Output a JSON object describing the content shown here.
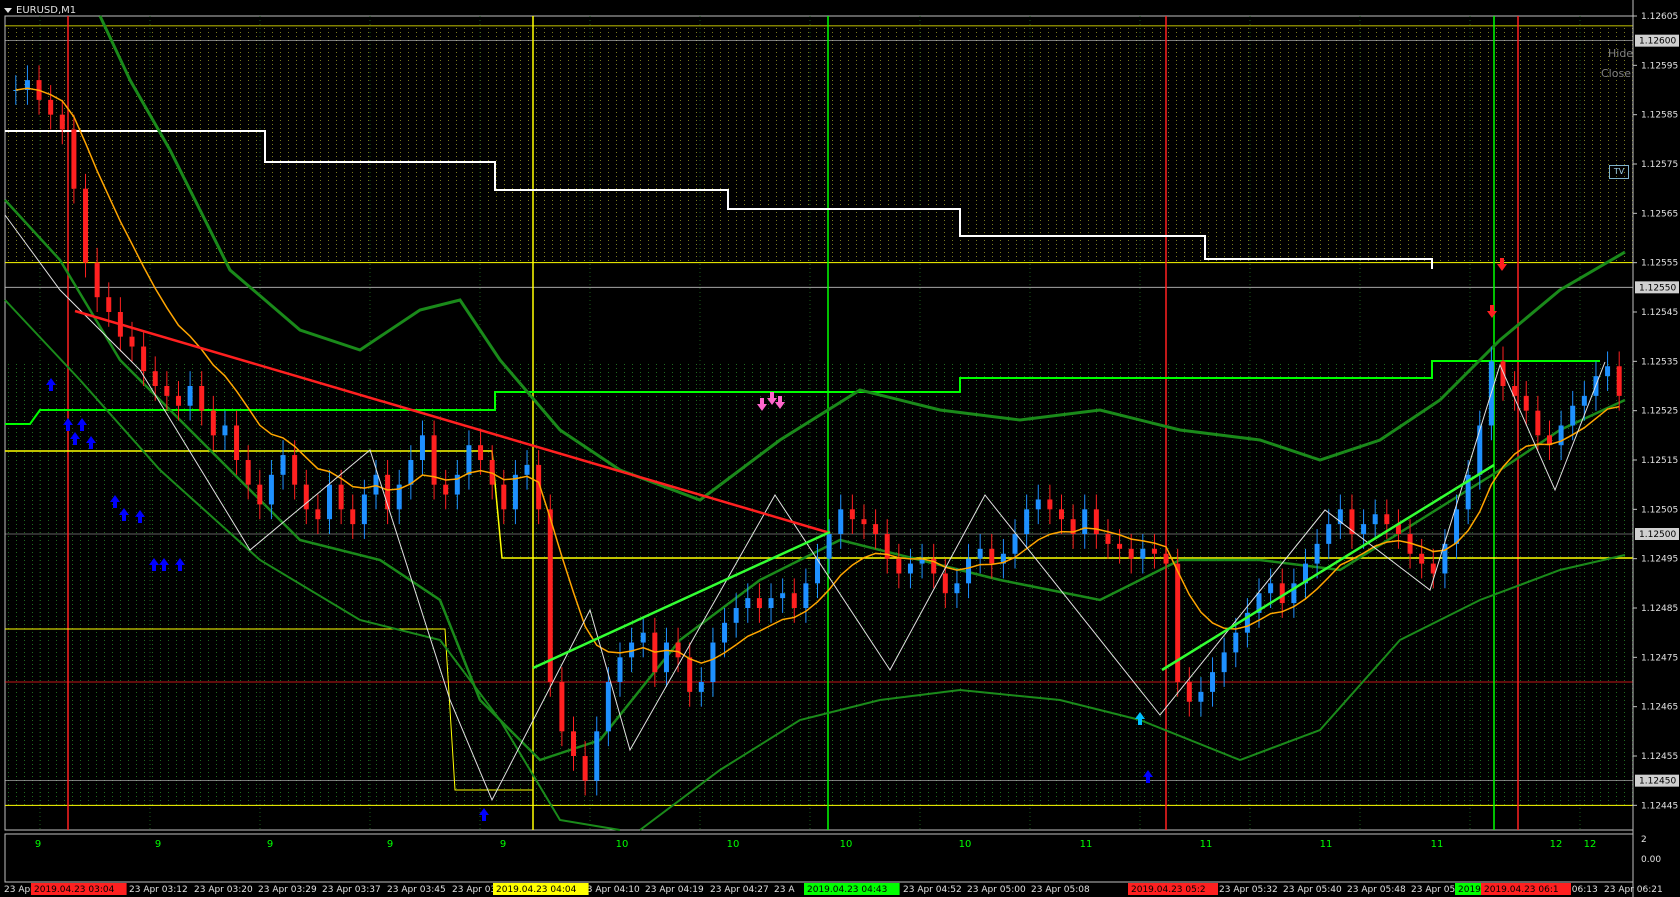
{
  "window": {
    "title": "EURUSD,M1"
  },
  "controls": {
    "hide": "Hide",
    "close": "Close",
    "tv": "TV"
  },
  "colors": {
    "background": "#000000",
    "bull_candle": "#1e90ff",
    "bear_candle": "#ff2020",
    "ma_orange": "#ffa500",
    "band_green": "#1a7a1a",
    "level_yellow": "#ffff00",
    "level_white": "#ffffff",
    "level_lime": "#00ff00",
    "trend_red": "#ff2020",
    "trend_green": "#33ff33"
  },
  "price_axis": {
    "min": 1.1244,
    "max": 1.12605,
    "ticks": [
      "1.12605",
      "1.12595",
      "1.12585",
      "1.12575",
      "1.12565",
      "1.12555",
      "1.12545",
      "1.12535",
      "1.12525",
      "1.12515",
      "1.12505",
      "1.12495",
      "1.12485",
      "1.12475",
      "1.12465",
      "1.12455",
      "1.12445"
    ],
    "badges": [
      {
        "label": "1.12600",
        "price": 1.126
      },
      {
        "label": "1.12550",
        "price": 1.1255
      },
      {
        "label": "1.12500",
        "price": 1.125
      },
      {
        "label": "1.12450",
        "price": 1.1245
      }
    ]
  },
  "subwindow": {
    "top_label": "2",
    "bottom_label": "0.00",
    "counter_labels": [
      "9",
      "9",
      "9",
      "9",
      "9",
      "10",
      "10",
      "10",
      "10",
      "11",
      "11",
      "11",
      "11",
      "12",
      "12"
    ]
  },
  "time_axis": {
    "labels": [
      "23 Apr",
      "23 Apr 03:04",
      "23 Apr 03:12",
      "23 Apr 03:20",
      "23 Apr 03:29",
      "23 Apr 03:37",
      "23 Apr 03:45",
      "23 Apr 03",
      "23 Apr 04:10",
      "23 Apr 04:19",
      "23 Apr 04:27",
      "23 A",
      "04:44",
      "23 Apr 04:52",
      "23 Apr 05:00",
      "23 Apr 05:08",
      "23 Apr 05:32",
      "23 Apr 05:40",
      "23 Apr 05:48",
      "23 Apr 05",
      "23 Apr 06:13",
      "23 Apr 06:21"
    ],
    "highlights": [
      {
        "label": "2019.04.23 03:04",
        "color": "#ff2020"
      },
      {
        "label": "2019.04.23 04:04",
        "color": "#ffff00"
      },
      {
        "label": "2019.04.23 04:43",
        "color": "#00ff00"
      },
      {
        "label": "2019.04.23 05:2",
        "color": "#ff2020"
      },
      {
        "label": "2019.0",
        "color": "#00ff00"
      },
      {
        "label": "2019.04.23 06:1",
        "color": "#ff2020"
      }
    ]
  },
  "chart_data": {
    "type": "candlestick",
    "symbol": "EURUSD",
    "timeframe": "M1",
    "ylim": [
      1.1244,
      1.12605
    ],
    "closes": [
      1.1259,
      1.12592,
      1.12588,
      1.12585,
      1.12582,
      1.1257,
      1.12555,
      1.12548,
      1.12545,
      1.1254,
      1.12538,
      1.12533,
      1.1253,
      1.12528,
      1.12526,
      1.1253,
      1.12525,
      1.1252,
      1.12522,
      1.12515,
      1.1251,
      1.12506,
      1.12512,
      1.12516,
      1.1251,
      1.12505,
      1.12503,
      1.1251,
      1.12505,
      1.12502,
      1.12508,
      1.12512,
      1.12505,
      1.1251,
      1.12515,
      1.1252,
      1.1251,
      1.12508,
      1.12512,
      1.12518,
      1.12515,
      1.1251,
      1.12505,
      1.12512,
      1.12514,
      1.12505,
      1.1247,
      1.1246,
      1.12455,
      1.1245,
      1.1246,
      1.1247,
      1.12475,
      1.12478,
      1.1248,
      1.12472,
      1.12478,
      1.12475,
      1.12468,
      1.1247,
      1.12478,
      1.12482,
      1.12485,
      1.12487,
      1.12485,
      1.12487,
      1.12488,
      1.12485,
      1.1249,
      1.12495,
      1.125,
      1.12505,
      1.12503,
      1.12502,
      1.125,
      1.12495,
      1.12492,
      1.12494,
      1.12495,
      1.12492,
      1.12488,
      1.1249,
      1.12495,
      1.12497,
      1.12494,
      1.12496,
      1.125,
      1.12505,
      1.12507,
      1.12505,
      1.12503,
      1.125,
      1.12505,
      1.125,
      1.12498,
      1.12497,
      1.12495,
      1.12497,
      1.12496,
      1.12494,
      1.1247,
      1.12466,
      1.12468,
      1.12472,
      1.12476,
      1.1248,
      1.12484,
      1.12488,
      1.1249,
      1.12486,
      1.1249,
      1.12494,
      1.12498,
      1.12502,
      1.12505,
      1.125,
      1.12502,
      1.12504,
      1.12502,
      1.125,
      1.12496,
      1.12494,
      1.12492,
      1.12498,
      1.12505,
      1.12512,
      1.12522,
      1.12535,
      1.1253,
      1.12528,
      1.12525,
      1.1252,
      1.12518,
      1.12522,
      1.12526,
      1.12528,
      1.12532,
      1.12534,
      1.12528
    ]
  }
}
